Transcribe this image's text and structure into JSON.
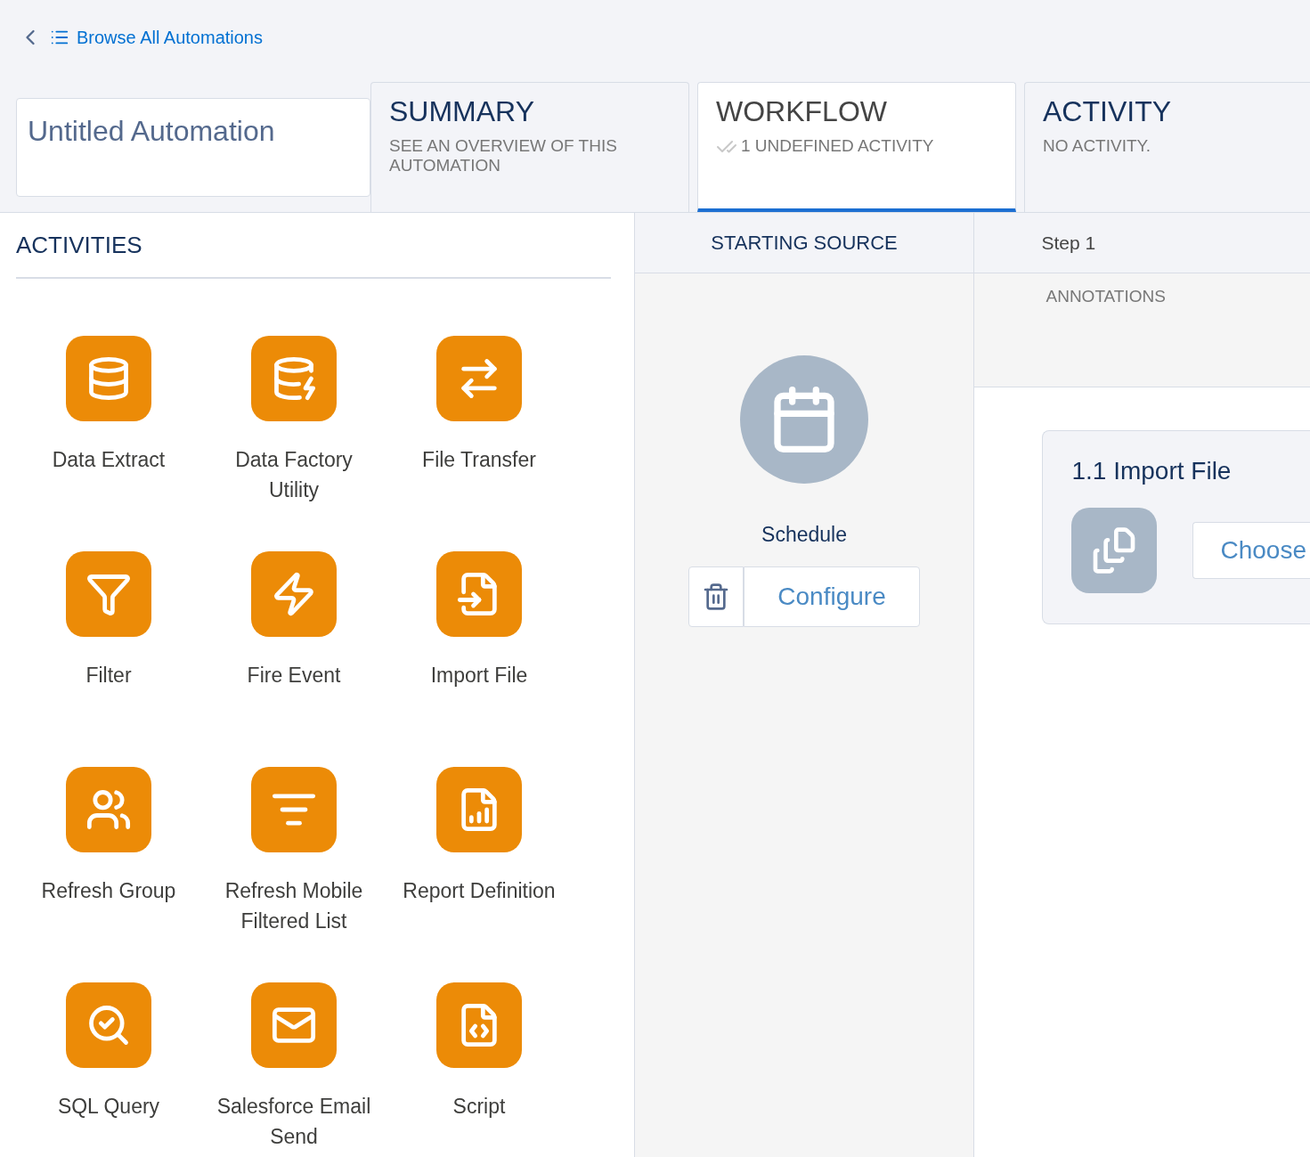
{
  "back_link": {
    "label": "Browse All Automations"
  },
  "title_field": {
    "value": "Untitled Automation"
  },
  "tabs": [
    {
      "label": "SUMMARY",
      "subtitle": "SEE AN OVERVIEW OF THIS AUTOMATION",
      "selected": false
    },
    {
      "label": "WORKFLOW",
      "subtitle": "1 UNDEFINED ACTIVITY",
      "selected": true
    },
    {
      "label": "ACTIVITY",
      "subtitle": "NO ACTIVITY.",
      "selected": false
    }
  ],
  "activities": {
    "title": "ACTIVITIES",
    "items": [
      {
        "label": "Data Extract"
      },
      {
        "label": "Data Factory Utility"
      },
      {
        "label": "File Transfer"
      },
      {
        "label": "Filter"
      },
      {
        "label": "Fire Event"
      },
      {
        "label": "Import File"
      },
      {
        "label": "Refresh Group"
      },
      {
        "label": "Refresh Mobile Filtered List"
      },
      {
        "label": "Report Definition"
      },
      {
        "label": "SQL Query"
      },
      {
        "label": "Salesforce Email Send"
      },
      {
        "label": "Script"
      }
    ]
  },
  "starting_source": {
    "header": "STARTING SOURCE",
    "label": "Schedule",
    "button": "Configure"
  },
  "step": {
    "header": "Step 1",
    "annotations": "ANNOTATIONS",
    "card": {
      "title": "1.1 Import File",
      "button": "Choose"
    }
  }
}
